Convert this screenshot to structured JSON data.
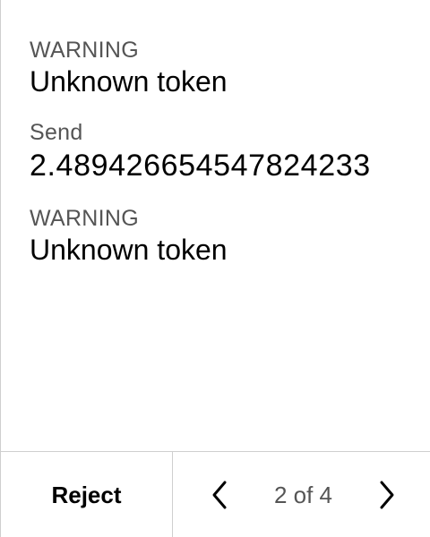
{
  "fields": [
    {
      "label": "WARNING",
      "value": "Unknown token"
    },
    {
      "label": "Send",
      "value": "2.489426654547824233"
    },
    {
      "label": "WARNING",
      "value": "Unknown token"
    }
  ],
  "footer": {
    "reject_label": "Reject",
    "page_indicator": "2 of 4",
    "prev_icon": "chevron-left-icon",
    "next_icon": "chevron-right-icon"
  },
  "colors": {
    "label": "#555555",
    "value": "#000000",
    "divider": "#cfcfcf"
  }
}
